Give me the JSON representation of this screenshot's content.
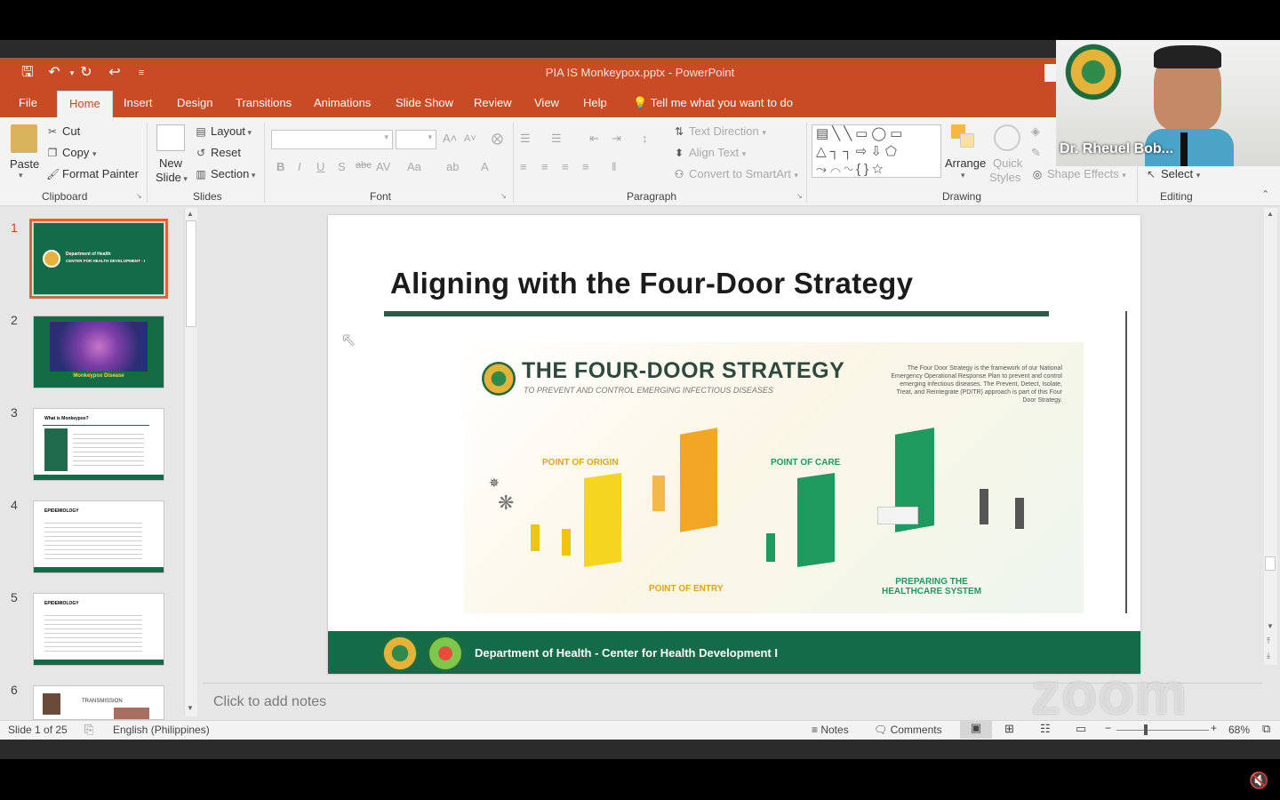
{
  "window": {
    "title": "PIA IS Monkeypox.pptx  -  PowerPoint"
  },
  "tabs": [
    "File",
    "Home",
    "Insert",
    "Design",
    "Transitions",
    "Animations",
    "Slide Show",
    "Review",
    "View",
    "Help"
  ],
  "tell_me": "Tell me what you want to do",
  "ribbon": {
    "clipboard": {
      "paste": "Paste",
      "cut": "Cut",
      "copy": "Copy",
      "format_painter": "Format Painter",
      "label": "Clipboard"
    },
    "slides": {
      "new_slide_1": "New",
      "new_slide_2": "Slide",
      "layout": "Layout",
      "reset": "Reset",
      "section": "Section",
      "label": "Slides"
    },
    "font": {
      "label": "Font"
    },
    "paragraph": {
      "text_direction": "Text Direction",
      "align_text": "Align Text",
      "convert": "Convert to SmartArt",
      "label": "Paragraph"
    },
    "drawing": {
      "arrange": "Arrange",
      "quick_styles_1": "Quick",
      "quick_styles_2": "Styles",
      "shape_effects": "Shape Effects",
      "label": "Drawing"
    },
    "editing": {
      "select": "Select",
      "label": "Editing"
    }
  },
  "thumbnails": [
    {
      "num": "1",
      "caption": "Department of Health",
      "caption2": "CENTER FOR HEALTH DEVELOPMENT - I"
    },
    {
      "num": "2",
      "caption": "Monkeypox Disease"
    },
    {
      "num": "3",
      "caption": "What is Monkeypox?"
    },
    {
      "num": "4",
      "caption": "EPIDEMIOLOGY"
    },
    {
      "num": "5",
      "caption": "EPIDEMIOLOGY"
    },
    {
      "num": "6",
      "caption": "TRANSMISSION"
    }
  ],
  "slide": {
    "title": "Aligning with the Four-Door Strategy",
    "strategy_title": "THE FOUR-DOOR STRATEGY",
    "strategy_subtitle": "TO PREVENT AND CONTROL EMERGING INFECTIOUS DISEASES",
    "strategy_desc": "The Four Door Strategy is the framework of our National Emergency Operational Response Plan to prevent and control emerging infectious diseases. The Prevent, Detect, Isolate, Treat, and Reintegrate (PDITR) approach is part of this Four Door Strategy.",
    "door1": "POINT OF ORIGIN",
    "door2": "POINT OF ENTRY",
    "door3": "POINT OF CARE",
    "door4a": "PREPARING THE",
    "door4b": "HEALTHCARE SYSTEM",
    "footer": "Department of Health - Center for Health Development I"
  },
  "notes_placeholder": "Click to add notes",
  "status": {
    "slide_counter": "Slide 1 of 25",
    "language": "English (Philippines)",
    "notes": "Notes",
    "comments": "Comments",
    "zoom": "68%"
  },
  "video": {
    "name": "Dr. Rheuel Bob..."
  },
  "watermark": "zoom",
  "colors": {
    "accent": "#c84b26",
    "slide_green": "#136b47",
    "door_orange": "#f2a623",
    "door_green": "#1f9a5e"
  }
}
